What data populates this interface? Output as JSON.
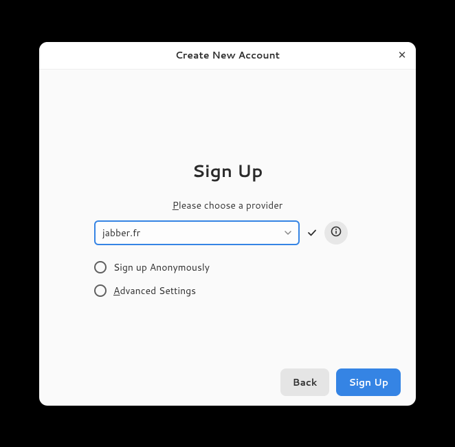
{
  "titlebar": {
    "title": "Create New Account"
  },
  "content": {
    "heading": "Sign Up",
    "subheading_prefix": "P",
    "subheading_rest": "lease choose a provider",
    "provider_value": "jabber.fr",
    "radio_anonymous": "Sign up Anonymously",
    "radio_advanced_prefix": "A",
    "radio_advanced_rest": "dvanced Settings"
  },
  "footer": {
    "back": "Back",
    "signup": "Sign Up"
  }
}
